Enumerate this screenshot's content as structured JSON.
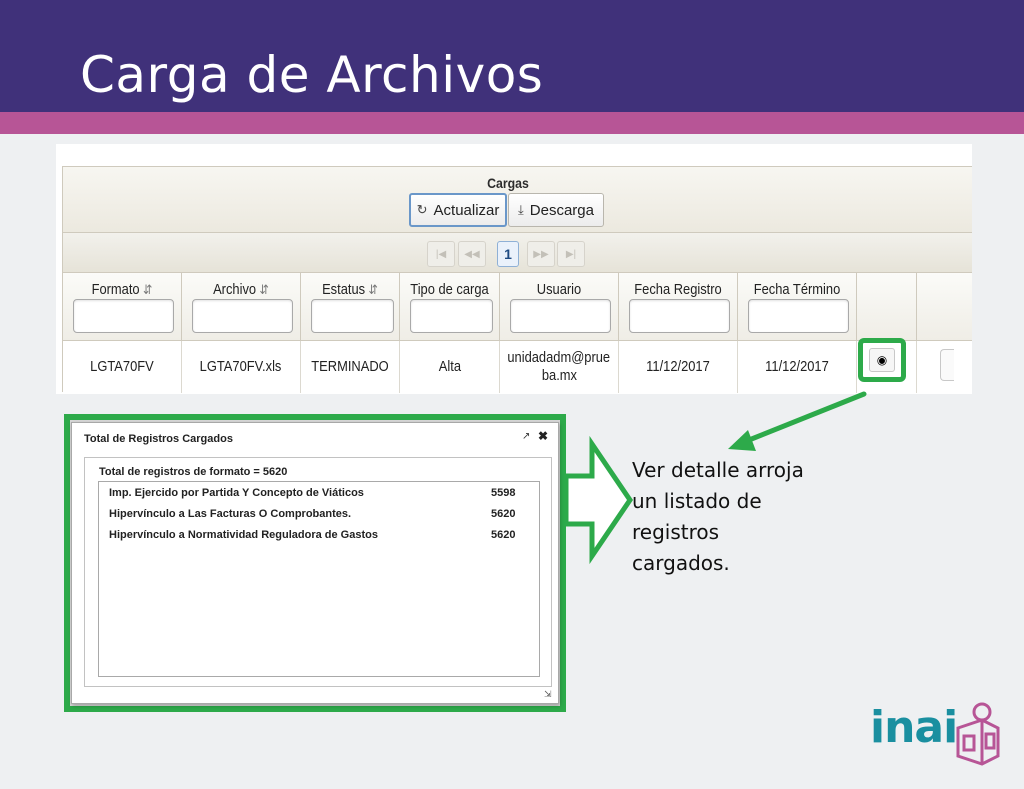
{
  "slide": {
    "title": "Carga de Archivos",
    "note_lines": [
      "Ver detalle arroja",
      "un listado de",
      "registros",
      "cargados."
    ],
    "colors": {
      "header": "#40317a",
      "stripe": "#b75596",
      "highlight": "#2daa4a",
      "logo": "#1a8fa0"
    }
  },
  "grid": {
    "caption": "Cargas",
    "buttons": {
      "refresh": "Actualizar",
      "download": "Descarga"
    },
    "pager": {
      "current_page": "1",
      "first_icon": "first-page-icon",
      "prev_icon": "prev-page-icon",
      "next_icon": "next-page-icon",
      "last_icon": "last-page-icon"
    },
    "columns": [
      "Formato",
      "Archivo",
      "Estatus",
      "Tipo de carga",
      "Usuario",
      "Fecha Registro",
      "Fecha Término"
    ],
    "row": {
      "formato": "LGTA70FV",
      "archivo": "LGTA70FV.xls",
      "estatus": "TERMINADO",
      "tipo": "Alta",
      "usuario_1": "unidadadm@prue",
      "usuario_2": "ba.mx",
      "fecha_registro": "11/12/2017",
      "fecha_termino": "11/12/2017"
    }
  },
  "dialog": {
    "title": "Total de Registros Cargados",
    "total_label": "Total de registros de formato = 5620",
    "items": [
      {
        "label": "Imp. Ejercido por Partida Y Concepto de Viáticos",
        "count": "5598"
      },
      {
        "label": "Hipervínculo a Las Facturas O Comprobantes.",
        "count": "5620"
      },
      {
        "label": "Hipervínculo a Normatividad Reguladora de Gastos",
        "count": "5620"
      }
    ]
  },
  "logo": {
    "text": "inai"
  }
}
